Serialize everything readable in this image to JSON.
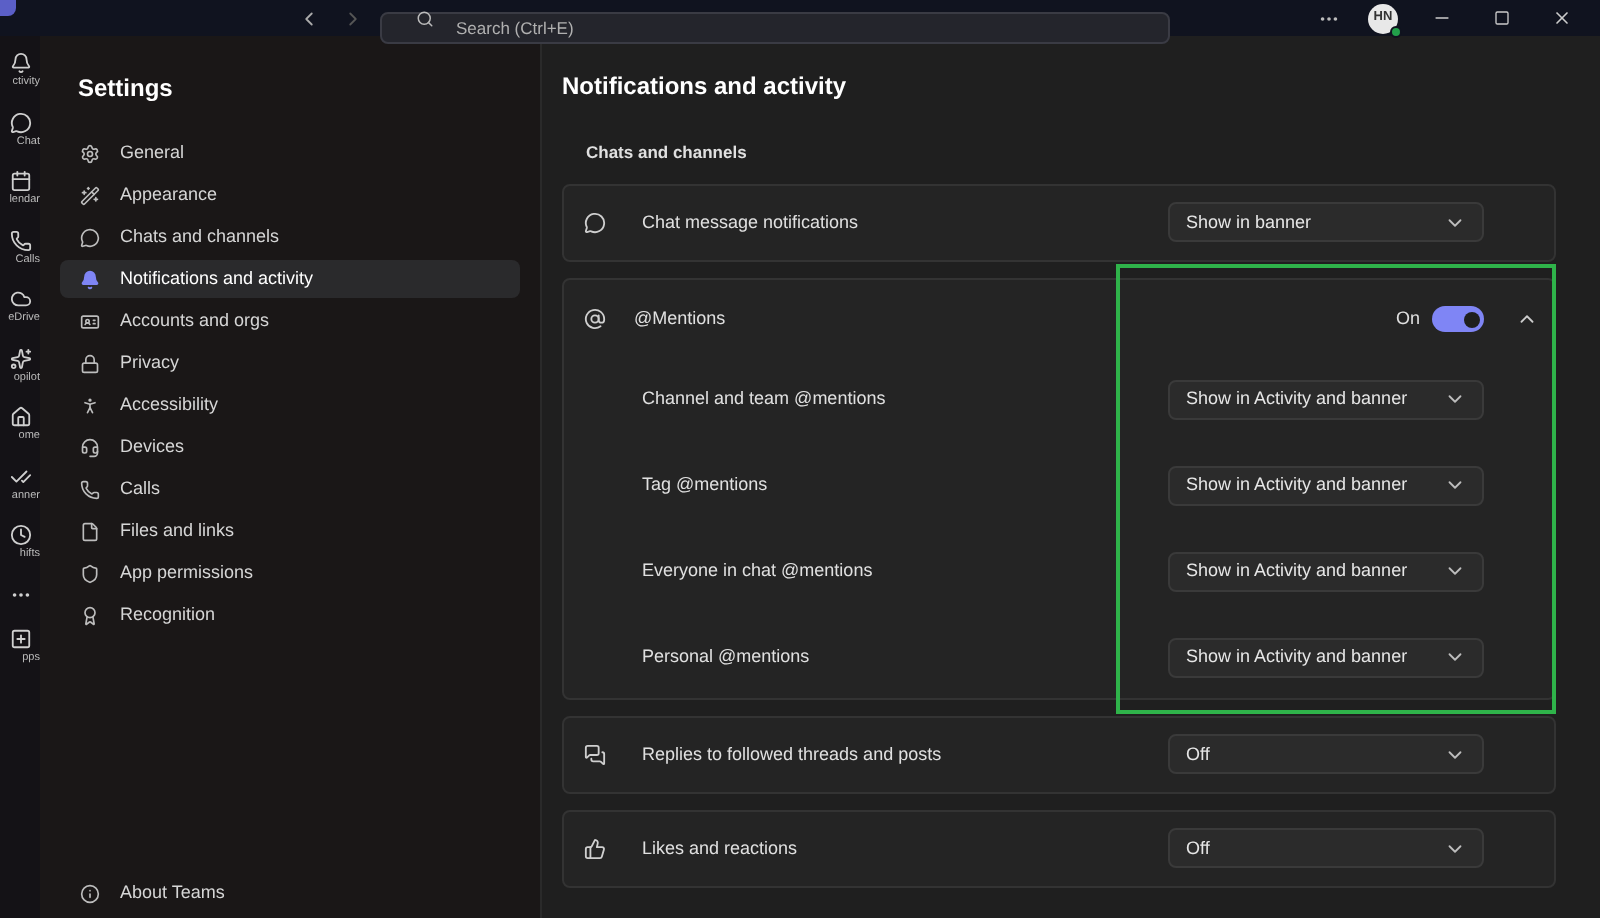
{
  "topbar": {
    "search": {
      "placeholder": "Search (Ctrl+E)"
    },
    "avatar": {
      "initials": "HN",
      "online": true
    }
  },
  "rail": [
    {
      "label": "ctivity"
    },
    {
      "label": "Chat"
    },
    {
      "label": "lendar"
    },
    {
      "label": "Calls"
    },
    {
      "label": "eDrive"
    },
    {
      "label": "opilot"
    },
    {
      "label": "ome"
    },
    {
      "label": "anner"
    },
    {
      "label": "hifts"
    },
    {
      "label": "pps"
    }
  ],
  "sidebar": {
    "title": "Settings",
    "items": [
      {
        "label": "General",
        "selected": false
      },
      {
        "label": "Appearance",
        "selected": false
      },
      {
        "label": "Chats and channels",
        "selected": false
      },
      {
        "label": "Notifications and activity",
        "selected": true
      },
      {
        "label": "Accounts and orgs",
        "selected": false
      },
      {
        "label": "Privacy",
        "selected": false
      },
      {
        "label": "Accessibility",
        "selected": false
      },
      {
        "label": "Devices",
        "selected": false
      },
      {
        "label": "Calls",
        "selected": false
      },
      {
        "label": "Files and links",
        "selected": false
      },
      {
        "label": "App permissions",
        "selected": false
      },
      {
        "label": "Recognition",
        "selected": false
      }
    ],
    "footer": {
      "label": "About Teams"
    }
  },
  "main": {
    "title": "Notifications and activity",
    "section": "Chats and channels",
    "cards": [
      {
        "kind": "select",
        "label": "Chat message notifications",
        "value": "Show in banner"
      },
      {
        "kind": "group",
        "label": "@Mentions",
        "toggle": {
          "label": "On",
          "on": true
        },
        "expanded": true,
        "highlighted": true,
        "rows": [
          {
            "label": "Channel and team @mentions",
            "value": "Show in Activity and banner"
          },
          {
            "label": "Tag @mentions",
            "value": "Show in Activity and banner"
          },
          {
            "label": "Everyone in chat @mentions",
            "value": "Show in Activity and banner"
          },
          {
            "label": "Personal @mentions",
            "value": "Show in Activity and banner"
          }
        ]
      },
      {
        "kind": "select",
        "label": "Replies to followed threads and posts",
        "value": "Off"
      },
      {
        "kind": "select",
        "label": "Likes and reactions",
        "value": "Off"
      }
    ]
  }
}
